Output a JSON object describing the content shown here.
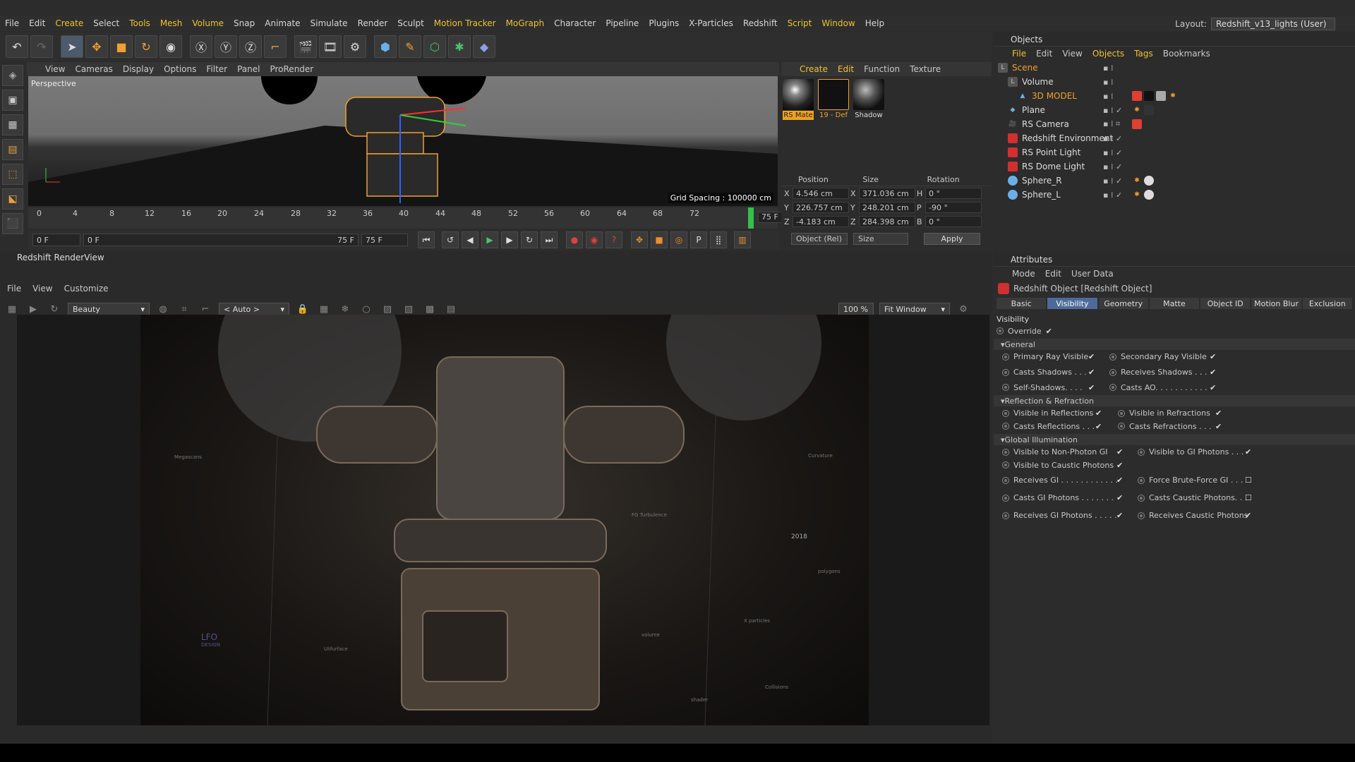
{
  "menu": [
    "File",
    "Edit",
    "Create",
    "Select",
    "Tools",
    "Mesh",
    "Volume",
    "Snap",
    "Animate",
    "Simulate",
    "Render",
    "Sculpt",
    "Motion Tracker",
    "MoGraph",
    "Character",
    "Pipeline",
    "Plugins",
    "X-Particles",
    "Redshift",
    "Script",
    "Window",
    "Help"
  ],
  "layout": {
    "label": "Layout:",
    "value": "Redshift_v13_lights (User)"
  },
  "viewport": {
    "menu": [
      "View",
      "Cameras",
      "Display",
      "Options",
      "Filter",
      "Panel",
      "ProRender"
    ],
    "label": "Perspective",
    "grid_spacing": "Grid Spacing : 100000 cm"
  },
  "timeline": {
    "ticks": [
      "0",
      "4",
      "8",
      "12",
      "16",
      "20",
      "24",
      "28",
      "32",
      "36",
      "40",
      "44",
      "48",
      "52",
      "56",
      "60",
      "64",
      "68",
      "72"
    ],
    "frame": "75 F"
  },
  "transport": {
    "start": "0 F",
    "range_start": "0 F",
    "range_end": "75 F",
    "end": "75 F"
  },
  "materials": {
    "menu": [
      "Create",
      "Edit",
      "Function",
      "Texture"
    ],
    "items": [
      "RS Mate",
      "19 - Def",
      "Shadow"
    ]
  },
  "coords": {
    "headers": [
      "Position",
      "Size",
      "Rotation"
    ],
    "rows": [
      {
        "a": "X",
        "p": "4.546 cm",
        "b": "X",
        "s": "371.036 cm",
        "c": "H",
        "r": "0 °"
      },
      {
        "a": "Y",
        "p": "226.757 cm",
        "b": "Y",
        "s": "248.201 cm",
        "c": "P",
        "r": "-90 °"
      },
      {
        "a": "Z",
        "p": "-4.183 cm",
        "b": "Z",
        "s": "284.398 cm",
        "c": "B",
        "r": "0 °"
      }
    ],
    "mode": "Object (Rel)",
    "size_mode": "Size",
    "apply": "Apply"
  },
  "objects": {
    "title": "Objects",
    "menu": [
      "File",
      "Edit",
      "View",
      "Objects",
      "Tags",
      "Bookmarks"
    ],
    "rows": [
      "Scene",
      "Volume",
      "3D MODEL",
      "Plane",
      "RS Camera",
      "Redshift Environment",
      "RS Point Light",
      "RS Dome Light",
      "Sphere_R",
      "Sphere_L"
    ]
  },
  "renderview": {
    "title": "Redshift RenderView",
    "menu": [
      "File",
      "View",
      "Customize"
    ],
    "aov": "Beauty",
    "auto": "< Auto >",
    "zoom": "100 %",
    "fit": "Fit Window"
  },
  "image_annotations": [
    "Megascans",
    "LFO",
    "DESIGN",
    "2018",
    "Curvature",
    "FG Turbulence",
    "volume",
    "Ulifurface",
    "X particles",
    "Collisions",
    "shader",
    "polygons"
  ],
  "attributes": {
    "title": "Attributes",
    "menu": [
      "Mode",
      "Edit",
      "User Data"
    ],
    "object": "Redshift Object [Redshift Object]",
    "tabs": [
      "Basic",
      "Visibility",
      "Geometry",
      "Matte",
      "Object ID",
      "Motion Blur",
      "Exclusion"
    ],
    "section": "Visibility",
    "override": "Override",
    "groups": {
      "general": "General",
      "refl": "Reflection & Refraction",
      "gi": "Global Illumination"
    },
    "general": [
      [
        "Primary Ray Visible",
        "Secondary Ray Visible"
      ],
      [
        "Casts Shadows . . .",
        "Receives Shadows . . ."
      ],
      [
        "Self-Shadows. . . .",
        "Casts AO. . . . . . . . . . ."
      ]
    ],
    "refl": [
      [
        "Visible in Reflections",
        "Visible in Refractions"
      ],
      [
        "Casts Reflections . . .",
        "Casts Refractions . . ."
      ]
    ],
    "gi": [
      [
        "Visible to Non-Photon GI",
        "Visible to GI Photons . . ."
      ],
      [
        "Visible to Caustic Photons",
        ""
      ],
      [
        "Receives GI . . . . . . . . . . . .",
        "Force Brute-Force GI . . ."
      ],
      [
        "Casts GI Photons . . . . . . .",
        "Casts Caustic Photons. . ."
      ],
      [
        "Receives GI Photons . . . . .",
        "Receives Caustic Photons"
      ]
    ]
  }
}
